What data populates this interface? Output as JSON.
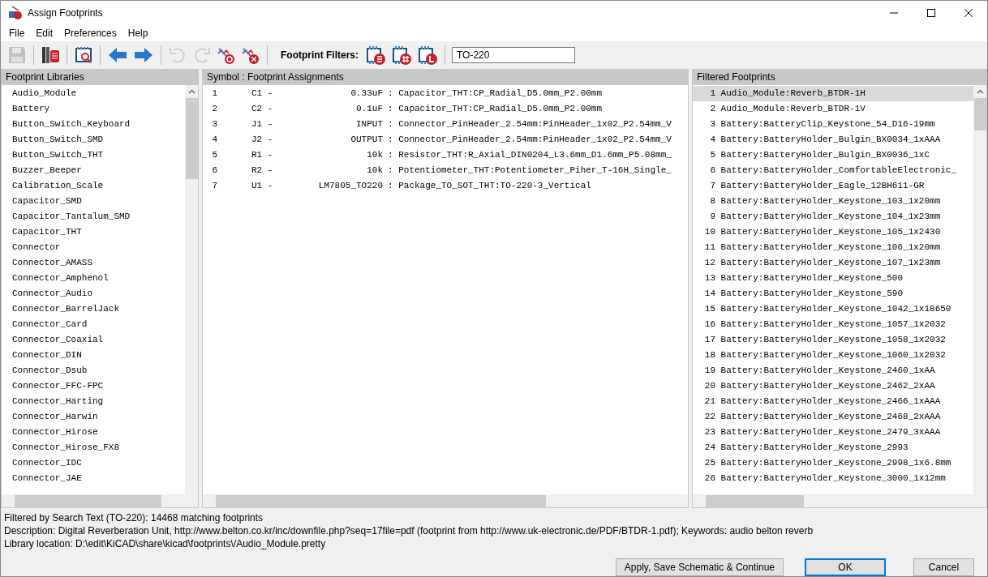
{
  "window": {
    "title": "Assign Footprints"
  },
  "menu": [
    "File",
    "Edit",
    "Preferences",
    "Help"
  ],
  "toolbar": {
    "buttons": [
      {
        "kind": "save",
        "disabled": true
      },
      {
        "kind": "sep"
      },
      {
        "kind": "libraries",
        "disabled": false
      },
      {
        "kind": "sep"
      },
      {
        "kind": "viewer",
        "disabled": false
      },
      {
        "kind": "sep"
      },
      {
        "kind": "prev",
        "disabled": false
      },
      {
        "kind": "next",
        "disabled": false
      },
      {
        "kind": "sep"
      },
      {
        "kind": "undo",
        "disabled": true
      },
      {
        "kind": "redo",
        "disabled": true
      },
      {
        "kind": "auto",
        "disabled": false
      },
      {
        "kind": "clear",
        "disabled": false
      },
      {
        "kind": "sep"
      }
    ],
    "filter_label": "Footprint Filters:",
    "filters": [
      {
        "kind": "list"
      },
      {
        "kind": "pins"
      },
      {
        "kind": "library"
      }
    ],
    "filter_text": "TO-220"
  },
  "libraries": {
    "title": "Footprint Libraries",
    "items": [
      "Audio_Module",
      "Battery",
      "Button_Switch_Keyboard",
      "Button_Switch_SMD",
      "Button_Switch_THT",
      "Buzzer_Beeper",
      "Calibration_Scale",
      "Capacitor_SMD",
      "Capacitor_Tantalum_SMD",
      "Capacitor_THT",
      "Connector",
      "Connector_AMASS",
      "Connector_Amphenol",
      "Connector_Audio",
      "Connector_BarrelJack",
      "Connector_Card",
      "Connector_Coaxial",
      "Connector_DIN",
      "Connector_Dsub",
      "Connector_FFC-FPC",
      "Connector_Harting",
      "Connector_Harwin",
      "Connector_Hirose",
      "Connector_Hirose_FX8",
      "Connector_IDC",
      "Connector_JAE"
    ]
  },
  "assignments": {
    "title": "Symbol : Footprint Assignments",
    "rows": [
      {
        "index": "1",
        "ref": "C1 -",
        "value": "0.33uF",
        "footprint": ": Capacitor_THT:CP_Radial_D5.0mm_P2.00mm"
      },
      {
        "index": "2",
        "ref": "C2 -",
        "value": "0.1uF",
        "footprint": ": Capacitor_THT:CP_Radial_D5.0mm_P2.00mm"
      },
      {
        "index": "3",
        "ref": "J1 -",
        "value": "INPUT",
        "footprint": ": Connector_PinHeader_2.54mm:PinHeader_1x02_P2.54mm_V"
      },
      {
        "index": "4",
        "ref": "J2 -",
        "value": "OUTPUT",
        "footprint": ": Connector_PinHeader_2.54mm:PinHeader_1x02_P2.54mm_V"
      },
      {
        "index": "5",
        "ref": "R1 -",
        "value": "10k",
        "footprint": ": Resistor_THT:R_Axial_DIN0204_L3.6mm_D1.6mm_P5.08mm_"
      },
      {
        "index": "6",
        "ref": "R2 -",
        "value": "10k",
        "footprint": ": Potentiometer_THT:Potentiometer_Piher_T-16H_Single_"
      },
      {
        "index": "7",
        "ref": "U1 -",
        "value": "LM7805_TO220",
        "footprint": ": Package_TO_SOT_THT:TO-220-3_Vertical"
      }
    ]
  },
  "footprints": {
    "title": "Filtered Footprints",
    "items": [
      {
        "index": "1",
        "name": "Audio_Module:Reverb_BTDR-1H",
        "selected": true
      },
      {
        "index": "2",
        "name": "Audio_Module:Reverb_BTDR-1V",
        "selected": false
      },
      {
        "index": "3",
        "name": "Battery:BatteryClip_Keystone_54_D16-19mm",
        "selected": false
      },
      {
        "index": "4",
        "name": "Battery:BatteryHolder_Bulgin_BX0034_1xAAA",
        "selected": false
      },
      {
        "index": "5",
        "name": "Battery:BatteryHolder_Bulgin_BX0036_1xC",
        "selected": false
      },
      {
        "index": "6",
        "name": "Battery:BatteryHolder_ComfortableElectronic_",
        "selected": false
      },
      {
        "index": "7",
        "name": "Battery:BatteryHolder_Eagle_12BH611-GR",
        "selected": false
      },
      {
        "index": "8",
        "name": "Battery:BatteryHolder_Keystone_103_1x20mm",
        "selected": false
      },
      {
        "index": "9",
        "name": "Battery:BatteryHolder_Keystone_104_1x23mm",
        "selected": false
      },
      {
        "index": "10",
        "name": "Battery:BatteryHolder_Keystone_105_1x2430",
        "selected": false
      },
      {
        "index": "11",
        "name": "Battery:BatteryHolder_Keystone_106_1x20mm",
        "selected": false
      },
      {
        "index": "12",
        "name": "Battery:BatteryHolder_Keystone_107_1x23mm",
        "selected": false
      },
      {
        "index": "13",
        "name": "Battery:BatteryHolder_Keystone_500",
        "selected": false
      },
      {
        "index": "14",
        "name": "Battery:BatteryHolder_Keystone_590",
        "selected": false
      },
      {
        "index": "15",
        "name": "Battery:BatteryHolder_Keystone_1042_1x18650",
        "selected": false
      },
      {
        "index": "16",
        "name": "Battery:BatteryHolder_Keystone_1057_1x2032",
        "selected": false
      },
      {
        "index": "17",
        "name": "Battery:BatteryHolder_Keystone_1058_1x2032",
        "selected": false
      },
      {
        "index": "18",
        "name": "Battery:BatteryHolder_Keystone_1060_1x2032",
        "selected": false
      },
      {
        "index": "19",
        "name": "Battery:BatteryHolder_Keystone_2460_1xAA",
        "selected": false
      },
      {
        "index": "20",
        "name": "Battery:BatteryHolder_Keystone_2462_2xAA",
        "selected": false
      },
      {
        "index": "21",
        "name": "Battery:BatteryHolder_Keystone_2466_1xAAA",
        "selected": false
      },
      {
        "index": "22",
        "name": "Battery:BatteryHolder_Keystone_2468_2xAAA",
        "selected": false
      },
      {
        "index": "23",
        "name": "Battery:BatteryHolder_Keystone_2479_3xAAA",
        "selected": false
      },
      {
        "index": "24",
        "name": "Battery:BatteryHolder_Keystone_2993",
        "selected": false
      },
      {
        "index": "25",
        "name": "Battery:BatteryHolder_Keystone_2998_1x6.8mm",
        "selected": false
      },
      {
        "index": "26",
        "name": "Battery:BatteryHolder_Keystone_3000_1x12mm",
        "selected": false
      }
    ]
  },
  "status": [
    "Filtered by Search Text (TO-220): 14468 matching footprints",
    "Description: Digital Reverberation Unit, http://www.belton.co.kr/inc/downfile.php?seq=17file=pdf (footprint from http://www.uk-electronic.de/PDF/BTDR-1.pdf);  Keywords: audio belton reverb",
    "Library location: D:\\edit\\KiCAD\\share\\kicad\\footprints\\/Audio_Module.pretty"
  ],
  "buttons": [
    {
      "label": "Apply, Save Schematic & Continue",
      "default": false
    },
    {
      "label": "OK",
      "default": true
    },
    {
      "label": "Cancel",
      "default": false
    }
  ]
}
